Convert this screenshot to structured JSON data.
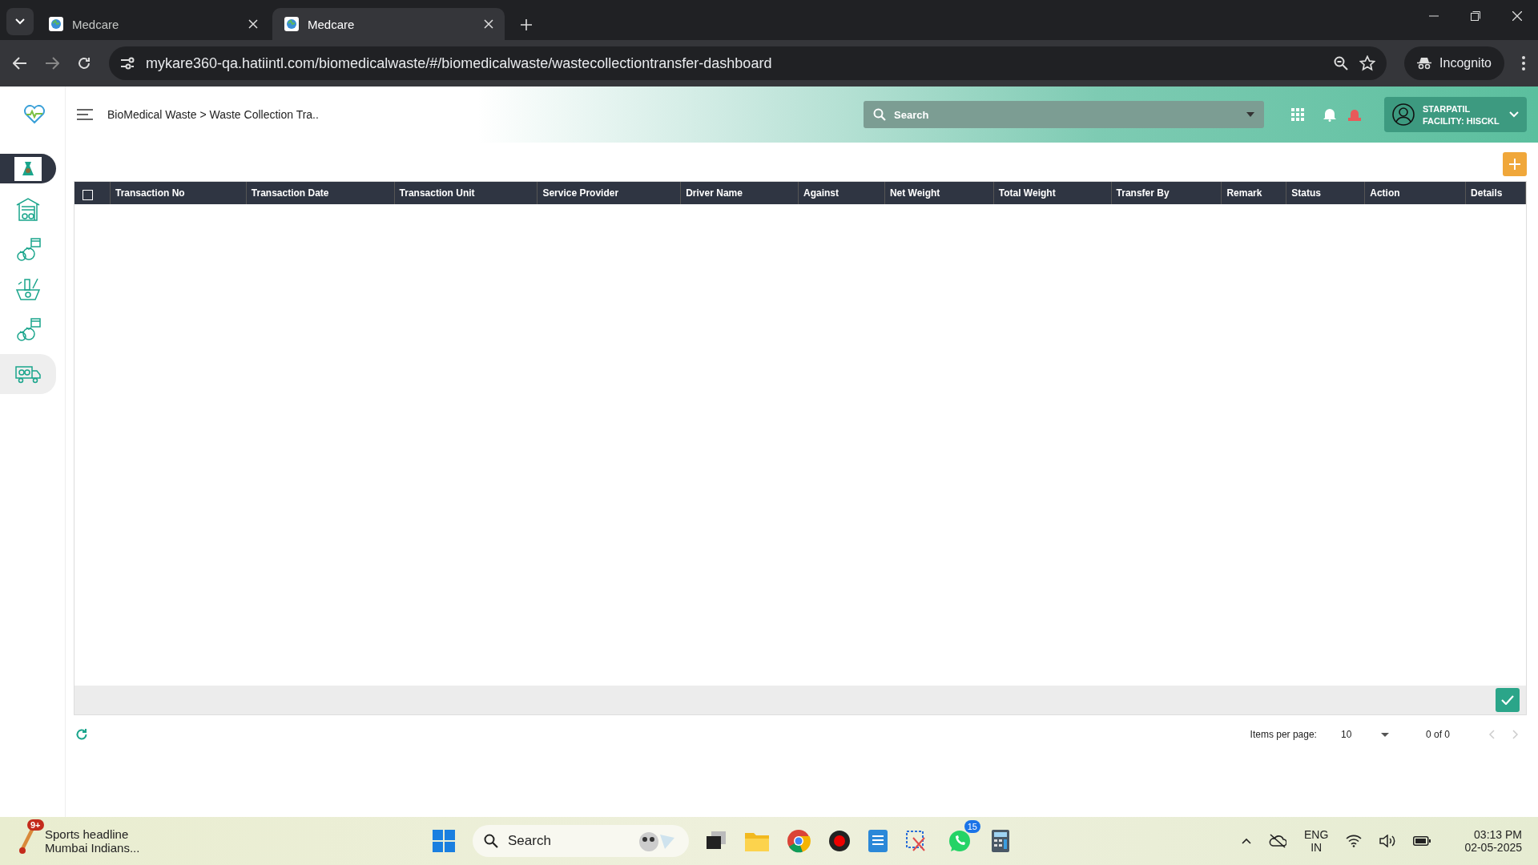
{
  "browser": {
    "tabs": [
      {
        "title": "Medcare",
        "selected": false
      },
      {
        "title": "Medcare",
        "selected": true
      }
    ],
    "url": "mykare360-qa.hatiintl.com/biomedicalwaste/#/biomedicalwaste/wastecollectiontransfer-dashboard",
    "profile": "Incognito"
  },
  "header": {
    "breadcrumb": "BioMedical Waste > Waste Collection Tra..",
    "search_placeholder": "Search",
    "user": "STARPATIL",
    "facility": "FACILITY: HISCKL"
  },
  "sidebar": {
    "items": [
      {
        "kind": "bag",
        "selected": true,
        "hovered": false
      },
      {
        "kind": "warehouse",
        "selected": false,
        "hovered": false
      },
      {
        "kind": "schedule",
        "selected": false,
        "hovered": false
      },
      {
        "kind": "basket",
        "selected": false,
        "hovered": false
      },
      {
        "kind": "schedule",
        "selected": false,
        "hovered": false
      },
      {
        "kind": "truck",
        "selected": false,
        "hovered": true
      }
    ]
  },
  "table": {
    "select_all_checked": false,
    "columns": [
      "Transaction No",
      "Transaction Date",
      "Transaction Unit",
      "Service Provider",
      "Driver Name",
      "Against",
      "Net Weight",
      "Total Weight",
      "Transfer By",
      "Remark",
      "Status",
      "Action",
      "Details"
    ]
  },
  "pagination": {
    "label": "Items per page:",
    "page_size": "10",
    "range": "0 of 0"
  },
  "taskbar": {
    "news_badge": "9+",
    "news_title": "Sports headline",
    "news_subtitle": "Mumbai Indians...",
    "search": "Search",
    "whatsapp_badge": "15",
    "lang": "ENG",
    "region": "IN",
    "time": "03:13 PM",
    "date": "02-05-2025"
  }
}
